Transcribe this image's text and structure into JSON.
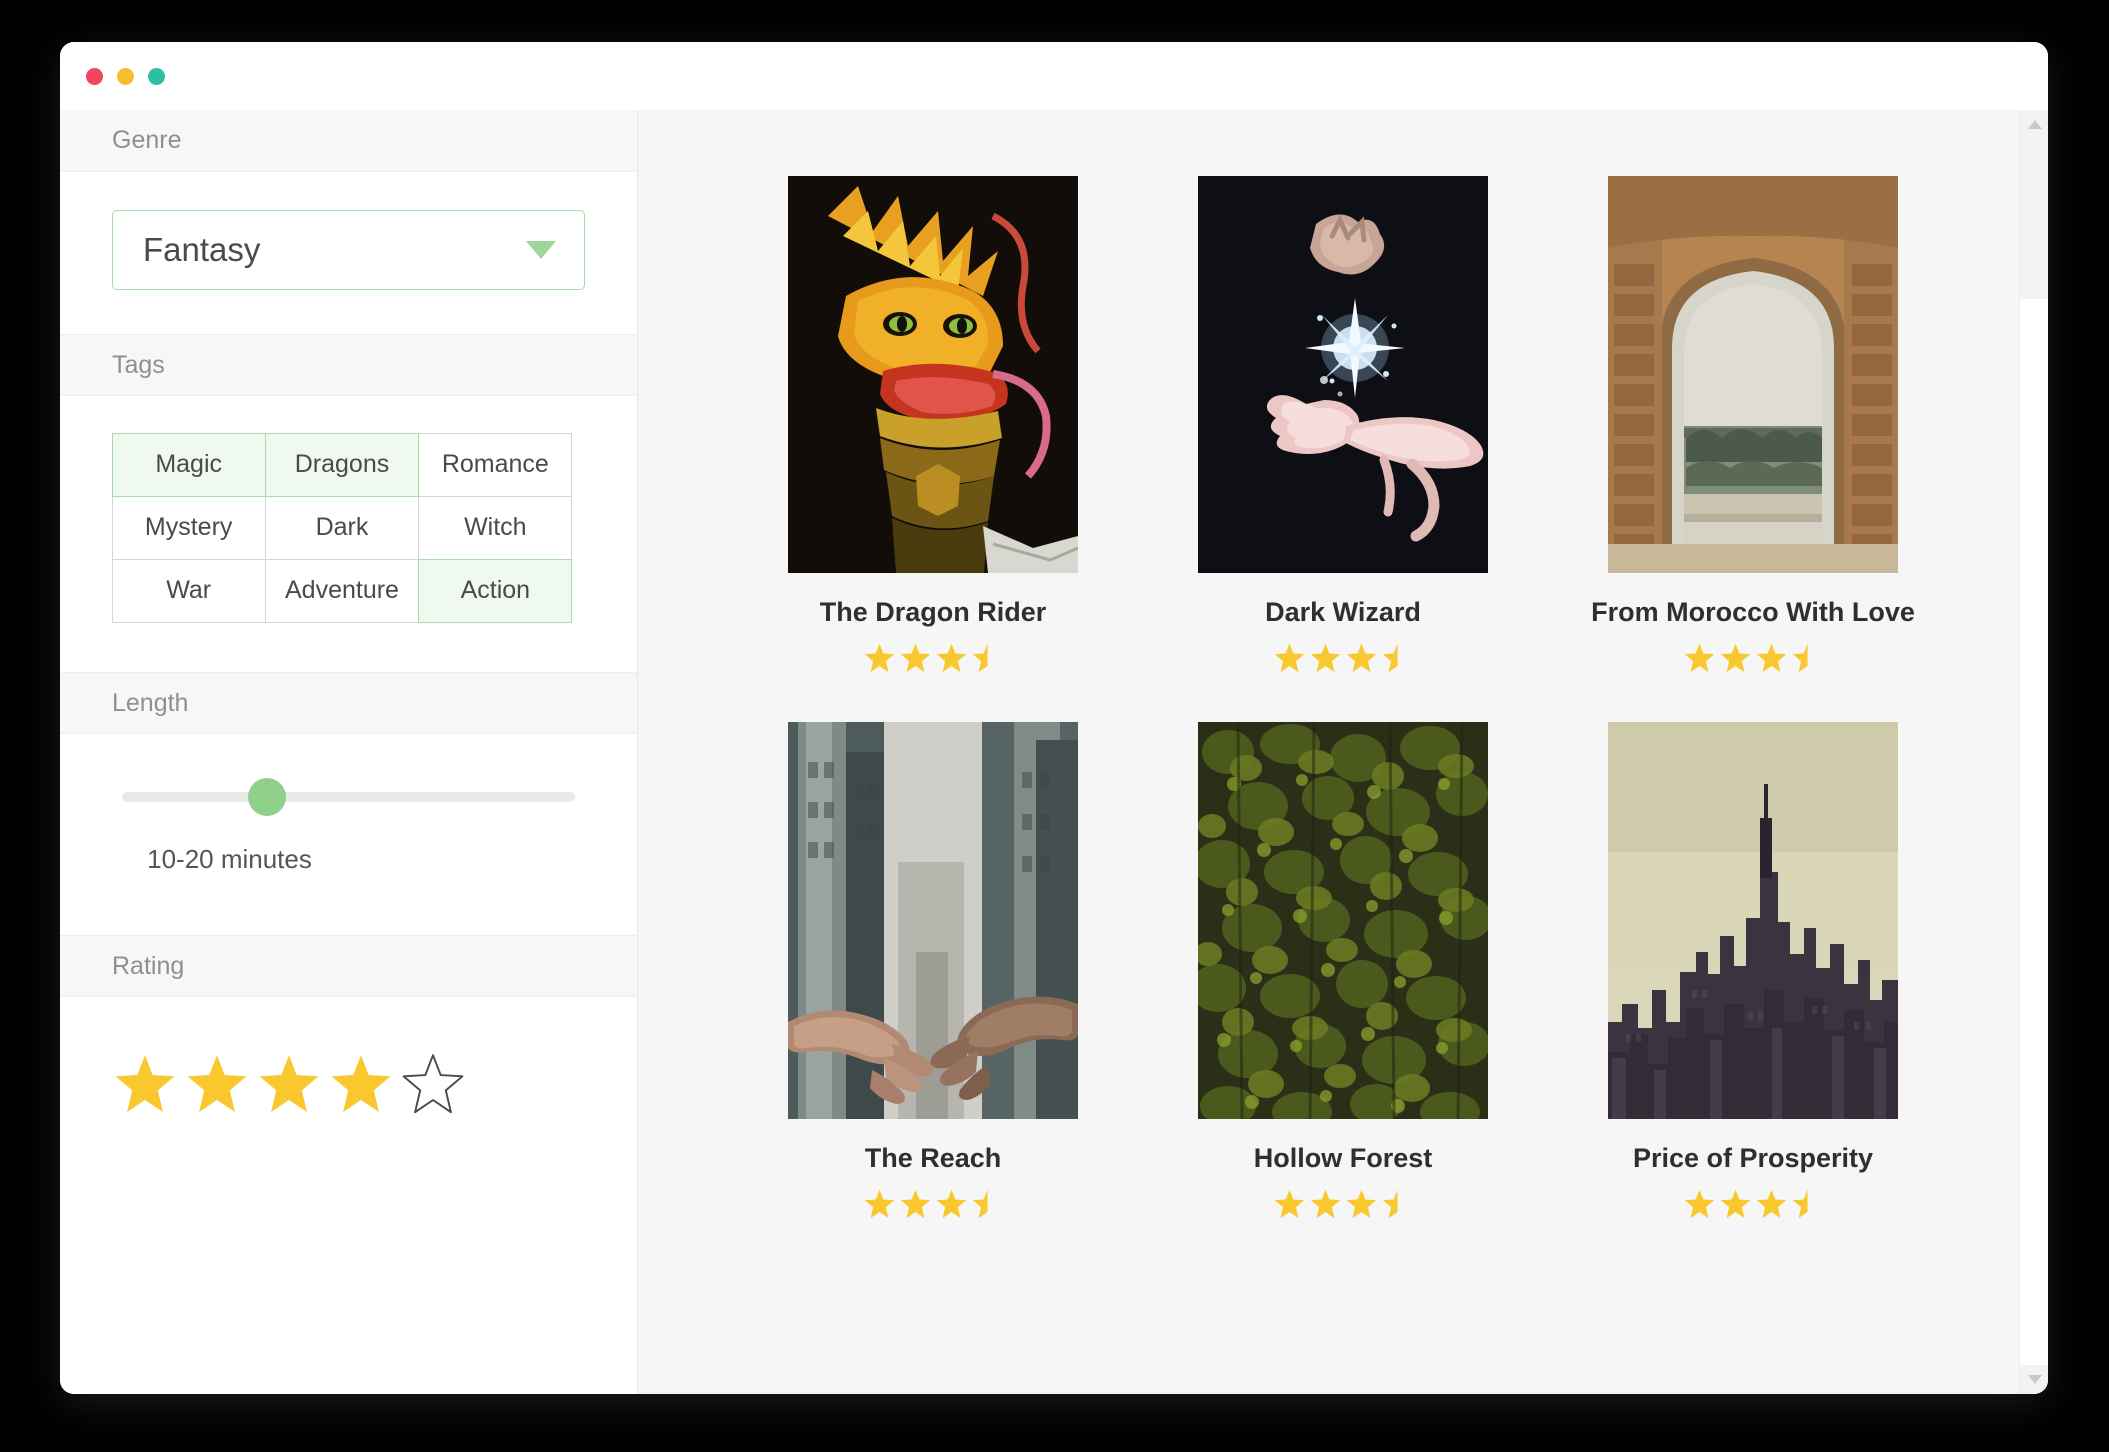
{
  "window": {
    "traffic_lights": [
      {
        "name": "close",
        "color": "#F0465F"
      },
      {
        "name": "minimize",
        "color": "#F6BE2C"
      },
      {
        "name": "maximize",
        "color": "#2DBFA4"
      }
    ]
  },
  "sidebar": {
    "genre": {
      "header": "Genre",
      "selected": "Fantasy",
      "arrow_icon": "chevron-down-icon",
      "accent": "#a8dba8"
    },
    "tags": {
      "header": "Tags",
      "items": [
        {
          "label": "Magic",
          "selected": true
        },
        {
          "label": "Dragons",
          "selected": true
        },
        {
          "label": "Romance",
          "selected": false
        },
        {
          "label": "Mystery",
          "selected": false
        },
        {
          "label": "Dark",
          "selected": false
        },
        {
          "label": "Witch",
          "selected": false
        },
        {
          "label": "War",
          "selected": false
        },
        {
          "label": "Adventure",
          "selected": false
        },
        {
          "label": "Action",
          "selected": true
        }
      ],
      "selected_bg": "#f0f9ef",
      "selected_border": "#a8dba8"
    },
    "length": {
      "header": "Length",
      "value_label": "10-20 minutes",
      "slider_percent": 32,
      "thumb_color": "#8fd08a",
      "track_color": "#e9e9e9"
    },
    "rating": {
      "header": "Rating",
      "value": 4,
      "max": 5,
      "star_color": "#F8C82E",
      "empty_star_border": "#4a4a4a",
      "stars": [
        {
          "state": "full"
        },
        {
          "state": "full"
        },
        {
          "state": "full"
        },
        {
          "state": "full"
        },
        {
          "state": "empty"
        }
      ]
    }
  },
  "content": {
    "cards": [
      {
        "title": "The Dragon Rider",
        "rating": 3.5,
        "stars": [
          "full",
          "full",
          "full",
          "half"
        ],
        "poster": "dragon-head-poster"
      },
      {
        "title": "Dark Wizard",
        "rating": 3.5,
        "stars": [
          "full",
          "full",
          "full",
          "half"
        ],
        "poster": "wizard-hands-spark-poster"
      },
      {
        "title": "From Morocco With Love",
        "rating": 3.5,
        "stars": [
          "full",
          "full",
          "full",
          "half"
        ],
        "poster": "moroccan-archway-poster"
      },
      {
        "title": "The Reach",
        "rating": 3.5,
        "stars": [
          "full",
          "full",
          "full",
          "half"
        ],
        "poster": "reaching-hands-city-poster"
      },
      {
        "title": "Hollow Forest",
        "rating": 3.5,
        "stars": [
          "full",
          "full",
          "full",
          "half"
        ],
        "poster": "dense-forest-poster"
      },
      {
        "title": "Price of Prosperity",
        "rating": 3.5,
        "stars": [
          "full",
          "full",
          "full",
          "half"
        ],
        "poster": "city-skyline-poster"
      }
    ],
    "star_color": "#F8C82E",
    "background": "#f6f6f6"
  },
  "scrollbar": {
    "up_arrow_icon": "triangle-up-icon",
    "down_arrow_icon": "triangle-down-icon"
  }
}
